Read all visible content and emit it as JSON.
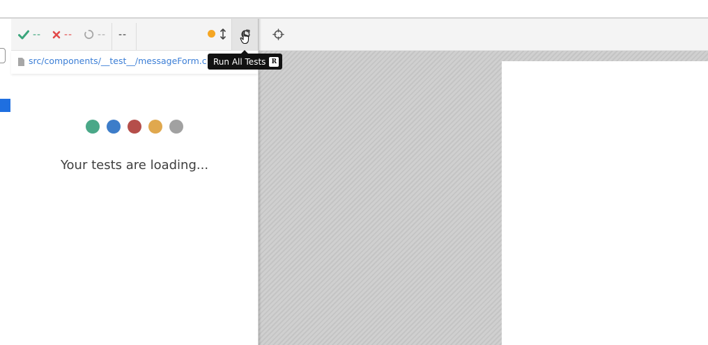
{
  "stats": {
    "passed": "--",
    "failed": "--",
    "pending": "--",
    "duration": "--"
  },
  "spec": {
    "path": "src/components/__test__/messageForm.cy.t"
  },
  "loading": {
    "message": "Your tests are loading..."
  },
  "tooltip": {
    "label": "Run All Tests",
    "shortcut": "R"
  },
  "colors": {
    "passed": "#3aa57b",
    "failed": "#e24a4a",
    "pending": "#a8a8a8",
    "running_indicator": "#f5a623",
    "link": "#3b7ed6",
    "loader_dots": [
      "#4aa888",
      "#3d7dc9",
      "#b54e4a",
      "#e0a84e",
      "#a1a1a1"
    ]
  },
  "icons": {
    "passed": "check-icon",
    "failed": "x-icon",
    "pending": "circle-notch-icon",
    "autoscroll": "arrows-vertical-icon",
    "rerun": "redo-icon",
    "selector": "crosshairs-icon",
    "file": "file-icon"
  }
}
